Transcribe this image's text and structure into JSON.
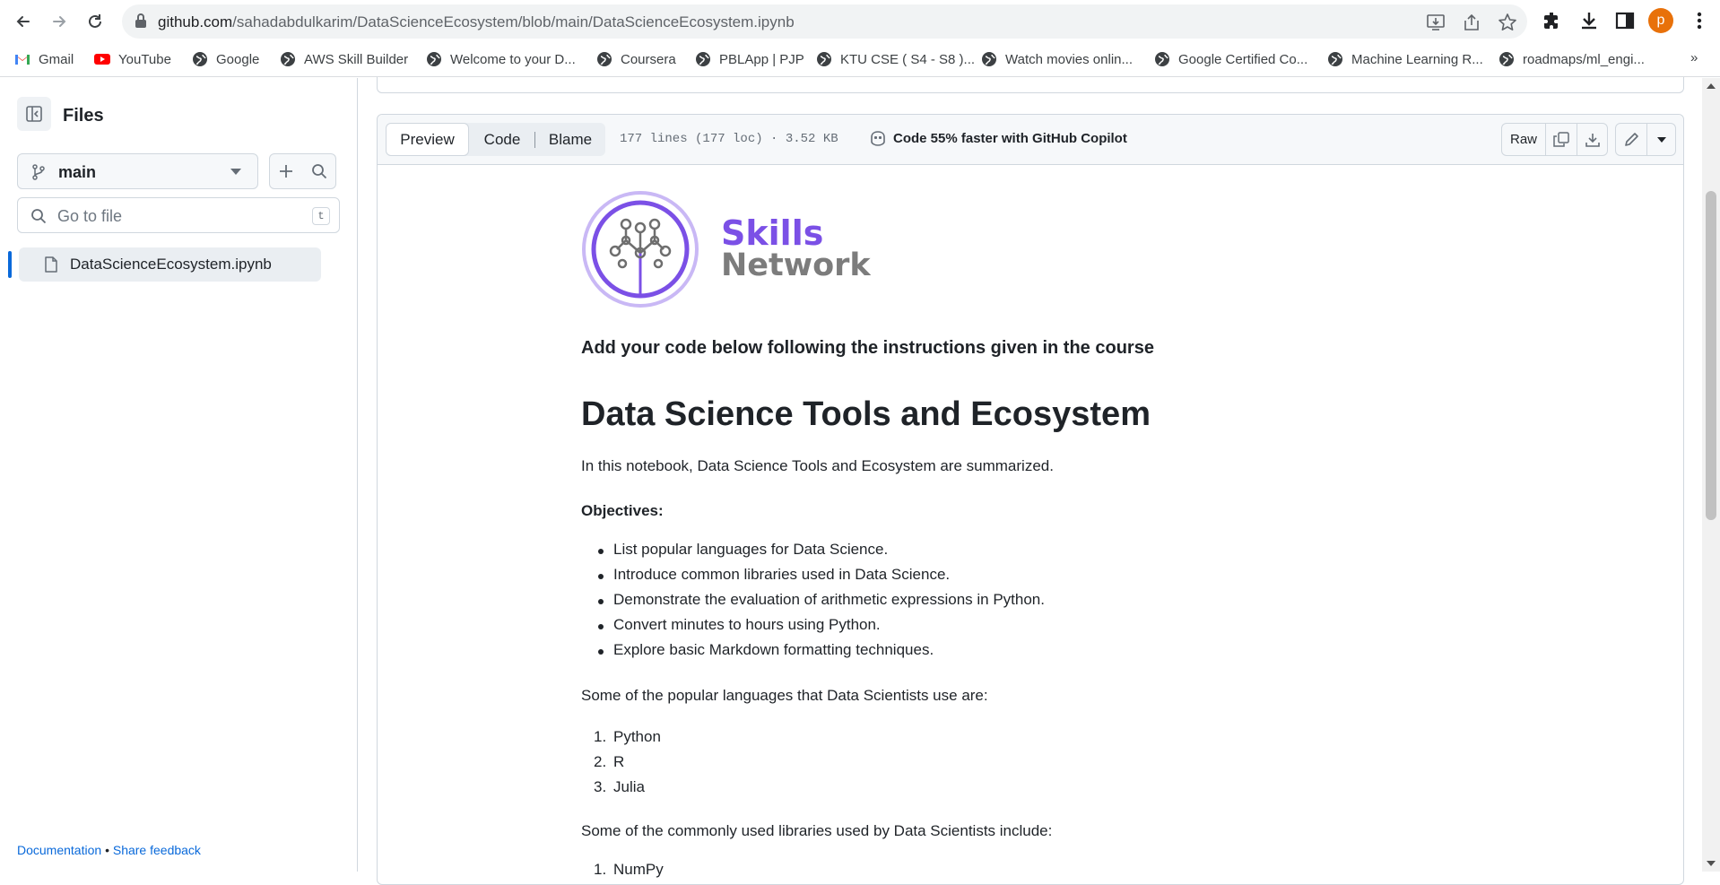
{
  "browser": {
    "url_host": "github.com",
    "url_path": "/sahadabdulkarim/DataScienceEcosystem/blob/main/DataScienceEcosystem.ipynb",
    "avatar_letter": "p",
    "bookmarks": [
      {
        "label": "Gmail",
        "icon": "gmail-icon"
      },
      {
        "label": "YouTube",
        "icon": "youtube-icon"
      },
      {
        "label": "Google",
        "icon": "globe-icon"
      },
      {
        "label": "AWS Skill Builder",
        "icon": "globe-icon"
      },
      {
        "label": "Welcome to your D...",
        "icon": "globe-icon"
      },
      {
        "label": "Coursera",
        "icon": "globe-icon"
      },
      {
        "label": "PBLApp | PJP",
        "icon": "globe-icon"
      },
      {
        "label": "KTU CSE ( S4 - S8 )...",
        "icon": "globe-icon"
      },
      {
        "label": "Watch movies onlin...",
        "icon": "globe-icon"
      },
      {
        "label": "Google Certified Co...",
        "icon": "globe-icon"
      },
      {
        "label": "Machine Learning R...",
        "icon": "globe-icon"
      },
      {
        "label": "roadmaps/ml_engi...",
        "icon": "globe-icon"
      }
    ],
    "more_bookmarks": "»"
  },
  "sidebar": {
    "title": "Files",
    "branch": "main",
    "goto_placeholder": "Go to file",
    "goto_shortcut": "t",
    "files": [
      {
        "name": "DataScienceEcosystem.ipynb"
      }
    ],
    "footer_doc": "Documentation",
    "footer_sep": "•",
    "footer_feedback": "Share feedback"
  },
  "file_header": {
    "tabs": [
      "Preview",
      "Code",
      "Blame"
    ],
    "active_tab": "Preview",
    "meta": "177 lines (177 loc) · 3.52 KB",
    "copilot": "Code 55% faster with GitHub Copilot",
    "raw_label": "Raw"
  },
  "notebook": {
    "logo_line1": "Skills",
    "logo_line2": "Network",
    "logo_colors": {
      "purple": "#7b50e6",
      "gray": "#7c7c7c"
    },
    "instruction": "Add your code below following the instructions given in the course",
    "heading": "Data Science Tools and Ecosystem",
    "intro": "In this notebook, Data Science Tools and Ecosystem are summarized.",
    "objectives_label": "Objectives:",
    "objectives": [
      "List popular languages for Data Science.",
      "Introduce common libraries used in Data Science.",
      "Demonstrate the evaluation of arithmetic expressions in Python.",
      "Convert minutes to hours using Python.",
      "Explore basic Markdown formatting techniques."
    ],
    "languages_intro": "Some of the popular languages that Data Scientists use are:",
    "languages": [
      "Python",
      "R",
      "Julia"
    ],
    "libraries_intro": "Some of the commonly used libraries used by Data Scientists include:",
    "libraries_partial": [
      "NumPy"
    ]
  },
  "colors": {
    "accent": "#0969da",
    "border": "#d0d7de",
    "header_bg": "#f6f8fa"
  }
}
